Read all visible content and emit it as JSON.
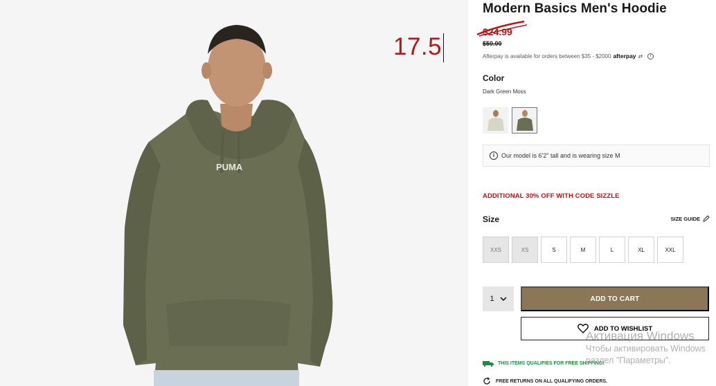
{
  "product": {
    "title": "Modern Basics Men's Hoodie",
    "sale_price": "$24.99",
    "original_price": "$50.00",
    "afterpay_text": "Afterpay is available for orders between $35 - $2000",
    "afterpay_brand": "afterpay",
    "annotation_value": "17.5"
  },
  "color": {
    "label": "Color",
    "selected": "Dark Green Moss",
    "swatch_colors": [
      "#d7d6c6",
      "#6a6e52"
    ]
  },
  "model_info": "Our model is 6'2\" tall and is wearing size M",
  "promo": "ADDITIONAL 30% OFF WITH CODE SIZZLE",
  "size": {
    "label": "Size",
    "guide_label": "SIZE GUIDE",
    "options": [
      "XXS",
      "XS",
      "S",
      "M",
      "L",
      "XL",
      "XXL"
    ],
    "unavailable": [
      "XXS",
      "XS"
    ]
  },
  "cart": {
    "quantity": "1",
    "add_to_cart_label": "ADD TO CART",
    "wishlist_label": "ADD TO WISHLIST"
  },
  "shipping": {
    "free_shipping": "THIS ITEMS QUALIFIES FOR FREE SHIPPING!",
    "free_returns": "FREE RETURNS ON ALL QUALIFYING ORDERS."
  },
  "windows_watermark": {
    "title": "Активация Windows",
    "line1": "Чтобы активировать Windows",
    "line2": "раздел \"Параметры\"."
  },
  "colors": {
    "sale_red": "#b41717",
    "cart_button": "#8b7656",
    "hoodie_olive": "#6a6e52",
    "shipping_green": "#1e8a3e"
  }
}
